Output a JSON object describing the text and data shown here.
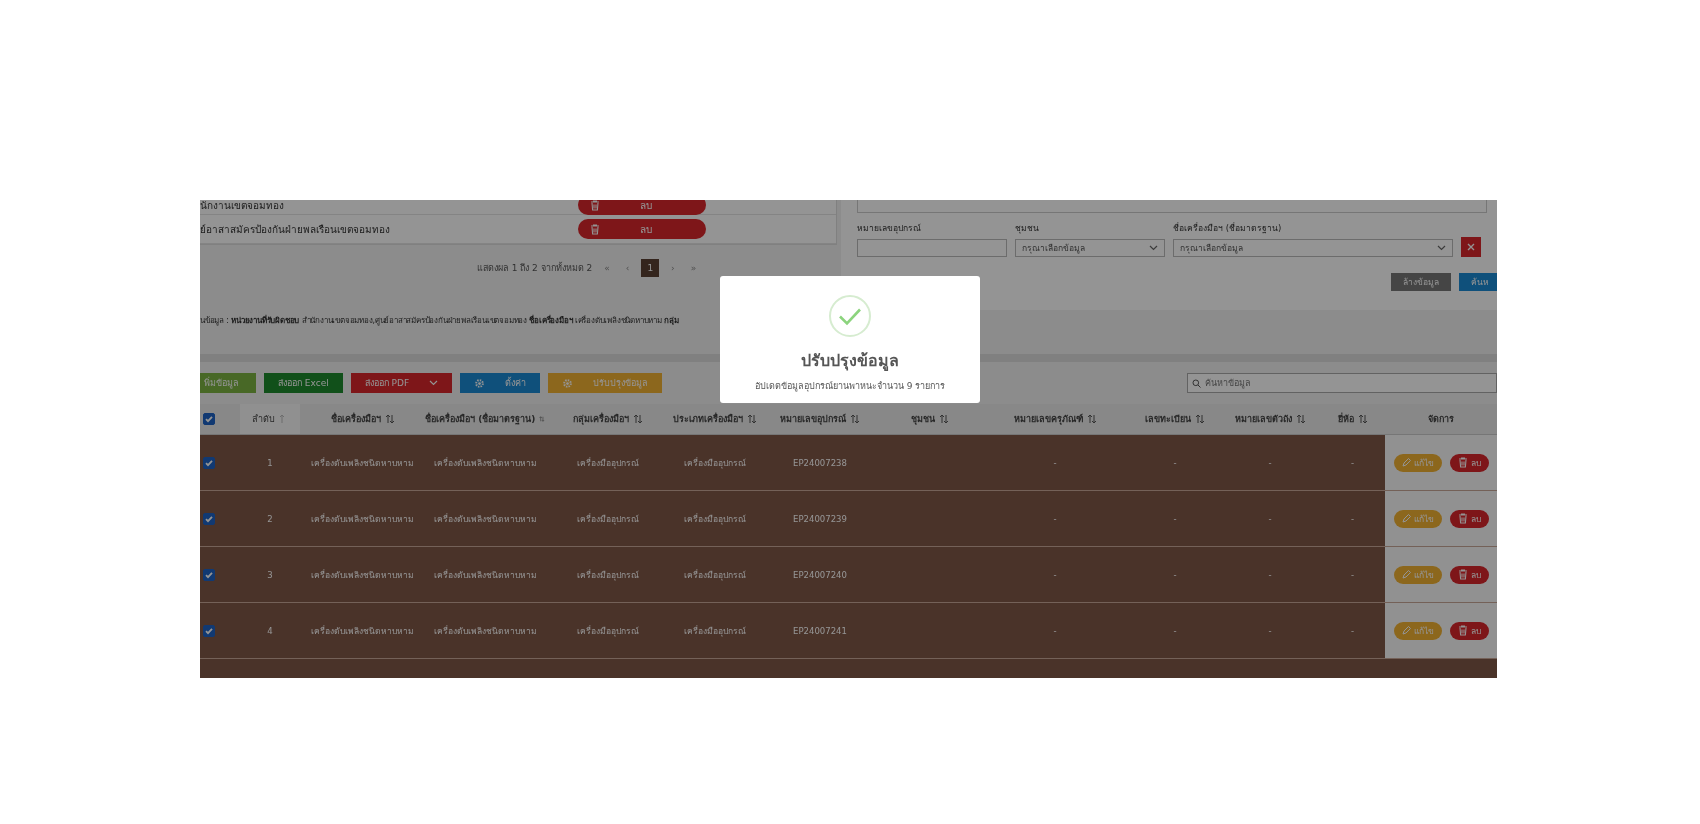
{
  "left_list": {
    "items": [
      {
        "name": "นักงานเขตจอมทอง",
        "delete": "ลบ"
      },
      {
        "name": "ย์อาสาสมัครป้องกันฝ่ายพลเรือนเขตจอมทอง",
        "delete": "ลบ"
      }
    ]
  },
  "pagination": {
    "summary": "แสดงผล 1 ถึง 2 จากทั้งหมด 2",
    "first": "«",
    "prev": "‹",
    "pages": [
      {
        "label": "1",
        "selected": true
      }
    ],
    "next": "›",
    "last": "»"
  },
  "filters": {
    "fields": [
      {
        "label": "หมายเลขอุปกรณ์",
        "kind": "input"
      },
      {
        "label": "ชุมชน",
        "kind": "select",
        "value": "กรุณาเลือกข้อมูล"
      },
      {
        "label": "ชื่อเครื่องมือฯ (ชื่อมาตรฐาน)",
        "kind": "select",
        "value": "กรุณาเลือกข้อมูล"
      }
    ],
    "reset_button": "ล้างข้อมูล",
    "search_button": "ค้นห"
  },
  "info": "นข้อมูล : **หน่วยงานที่รับผิดชอบ** สำนักงานเขตจอมทอง,ศูนย์อาสาสมัครป้องกันฝ่ายพลเรือนเขตจอมทอง **ชื่อเครื่องมือฯ** เครื่องดับเพลิงชนิดหาบหาม **กลุ่ม**",
  "toolbar": {
    "buttons": [
      {
        "label": "พิ่มข้อมูล",
        "kind": "add"
      },
      {
        "label": "ส่งออก Excel",
        "kind": "excel"
      },
      {
        "label": "ส่งออก PDF",
        "kind": "pdf"
      },
      {
        "label": "ตั้งค่า",
        "kind": "settings"
      },
      {
        "label": "ปรับปรุงข้อมูล",
        "kind": "update"
      }
    ]
  },
  "search": {
    "placeholder": "ค้นหาข้อมูล"
  },
  "table": {
    "all_checked": true,
    "columns": [
      {
        "label": "ลำดับ",
        "sorted": true
      },
      {
        "label": "ชื่อเครื่องมือฯ",
        "sorted": false
      },
      {
        "label": "ชื่อเครื่องมือฯ (ชื่อมาตรฐาน)",
        "sorted": false
      },
      {
        "label": "กลุ่มเครื่องมือฯ",
        "sorted": false
      },
      {
        "label": "ประเภทเครื่องมือฯ",
        "sorted": false
      },
      {
        "label": "หมายเลขอุปกรณ์",
        "sorted": false
      },
      {
        "label": "ชุมชน",
        "sorted": false
      },
      {
        "label": "หมายเลขครุภัณฑ์",
        "sorted": false
      },
      {
        "label": "เลขทะเบียน",
        "sorted": false
      },
      {
        "label": "หมายเลขตัวถัง",
        "sorted": false
      },
      {
        "label": "ยี่ห้อ",
        "sorted": false
      }
    ],
    "actions_label": "จัดการ",
    "rows": [
      {
        "checked": true,
        "selected": true,
        "cells": [
          "1",
          "เครื่องดับเพลิงชนิดหาบหาม",
          "เครื่องดับเพลิงชนิดหาบหาม",
          "เครื่องมืออุปกรณ์",
          "เครื่องมืออุปกรณ์",
          "EP24007238",
          null,
          "-",
          "-",
          "-",
          "-"
        ],
        "edit": "แก้ไข",
        "delete": "ลบ"
      },
      {
        "checked": true,
        "selected": true,
        "cells": [
          "2",
          "เครื่องดับเพลิงชนิดหาบหาม",
          "เครื่องดับเพลิงชนิดหาบหาม",
          "เครื่องมืออุปกรณ์",
          "เครื่องมืออุปกรณ์",
          "EP24007239",
          null,
          "-",
          "-",
          "-",
          "-"
        ],
        "edit": "แก้ไข",
        "delete": "ลบ"
      },
      {
        "checked": true,
        "selected": true,
        "cells": [
          "3",
          "เครื่องดับเพลิงชนิดหาบหาม",
          "เครื่องดับเพลิงชนิดหาบหาม",
          "เครื่องมืออุปกรณ์",
          "เครื่องมืออุปกรณ์",
          "EP24007240",
          null,
          "-",
          "-",
          "-",
          "-"
        ],
        "edit": "แก้ไข",
        "delete": "ลบ"
      },
      {
        "checked": true,
        "selected": true,
        "cells": [
          "4",
          "เครื่องดับเพลิงชนิดหาบหาม",
          "เครื่องดับเพลิงชนิดหาบหาม",
          "เครื่องมืออุปกรณ์",
          "เครื่องมืออุปกรณ์",
          "EP24007241",
          null,
          "-",
          "-",
          "-",
          "-"
        ],
        "edit": "แก้ไข",
        "delete": "ลบ"
      }
    ]
  },
  "modal": {
    "title": "ปรับปรุงข้อมูล",
    "message": "อัปเดตข้อมูลอุปกรณ์ยานพาหนะจำนวน 9 รายการ"
  }
}
